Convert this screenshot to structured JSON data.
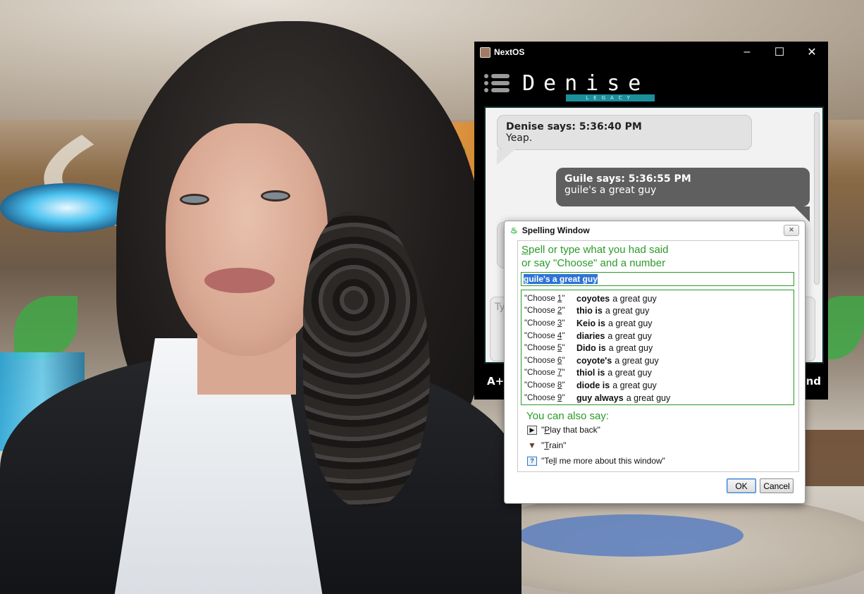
{
  "nextos": {
    "title": "NextOS",
    "window_controls": {
      "minimize": "–",
      "maximize": "☐",
      "close": "✕"
    },
    "logo": {
      "main": "Denise",
      "sub": "LEGACY"
    },
    "messages": [
      {
        "sender": "Denise says: 5:36:40 PM",
        "text": "Yeap."
      },
      {
        "sender": "Guile says: 5:36:55 PM",
        "text": "guile's a great guy"
      }
    ],
    "input_placeholder": "Ty",
    "footer": {
      "left": "A+",
      "right": "end"
    }
  },
  "spelling": {
    "title": "Spelling Window",
    "close_label": "✕",
    "instruction_line1_first": "S",
    "instruction_line1_rest": "pell or type what you had said",
    "instruction_line2": "or say \"Choose\" and a number",
    "input_value": "guile's a great guy",
    "choices": [
      {
        "cmd_pre": "\"Choose ",
        "num": "1",
        "cmd_post": "\"",
        "alt": "coyotes",
        "rest": "a great guy"
      },
      {
        "cmd_pre": "\"Choose ",
        "num": "2",
        "cmd_post": "\"",
        "alt": "thio is",
        "rest": "a great guy"
      },
      {
        "cmd_pre": "\"Choose ",
        "num": "3",
        "cmd_post": "\"",
        "alt": "Keio is",
        "rest": "a great guy"
      },
      {
        "cmd_pre": "\"Choose ",
        "num": "4",
        "cmd_post": "\"",
        "alt": "diaries",
        "rest": "a great guy"
      },
      {
        "cmd_pre": "\"Choose ",
        "num": "5",
        "cmd_post": "\"",
        "alt": "Dido is",
        "rest": "a great guy"
      },
      {
        "cmd_pre": "\"Choose ",
        "num": "6",
        "cmd_post": "\"",
        "alt": "coyote's",
        "rest": "a great guy"
      },
      {
        "cmd_pre": "\"Choose ",
        "num": "7",
        "cmd_post": "\"",
        "alt": "thiol is",
        "rest": "a great guy"
      },
      {
        "cmd_pre": "\"Choose ",
        "num": "8",
        "cmd_post": "\"",
        "alt": "diode is",
        "rest": "a great guy"
      },
      {
        "cmd_pre": "\"Choose ",
        "num": "9",
        "cmd_post": "\"",
        "alt": "guy always",
        "rest": "a great guy"
      }
    ],
    "also_label": "You can also say:",
    "options": [
      {
        "icon": "play-icon",
        "pre": "\"",
        "key": "P",
        "rest": "lay that back\""
      },
      {
        "icon": "train-icon",
        "pre": "\"",
        "key": "T",
        "rest": "rain\""
      },
      {
        "icon": "help-icon",
        "pre": "\"Te",
        "key": "l",
        "rest": "l me more about this window\""
      }
    ],
    "ok_label": "OK",
    "cancel_label": "Cancel",
    "icons": {
      "play": "▶",
      "train": "🎓",
      "help": "?"
    }
  },
  "colors": {
    "accent_green": "#2a9a2a",
    "selection_blue": "#2e72d6",
    "logo_teal": "#1b8f9c"
  }
}
